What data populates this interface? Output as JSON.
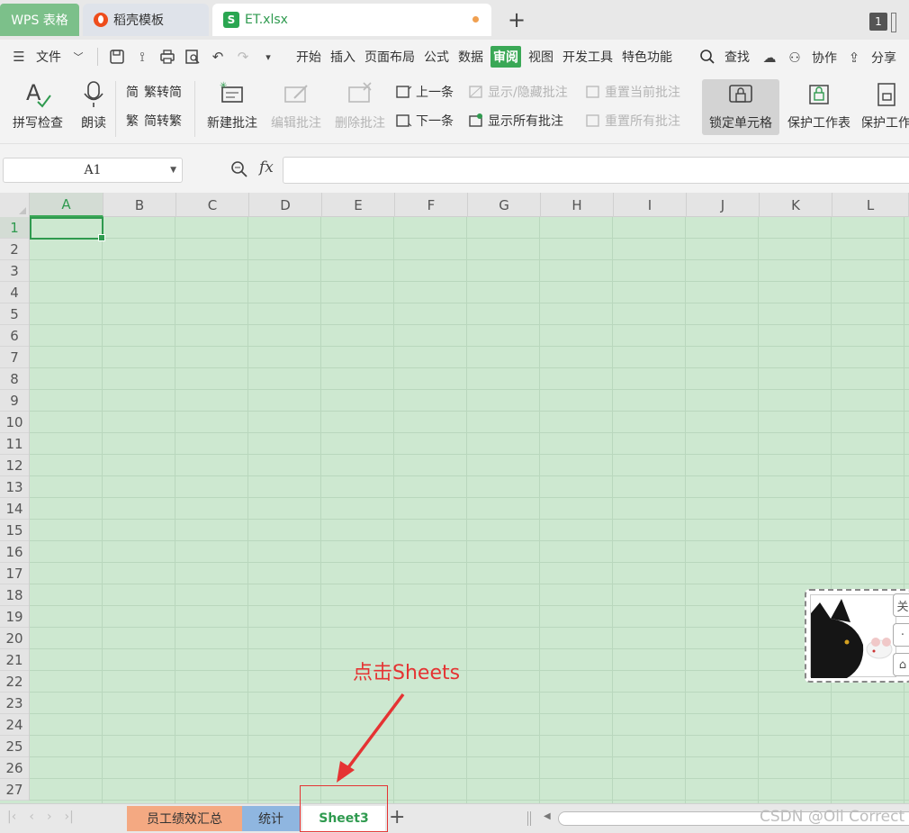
{
  "tabs": {
    "wps": "WPS 表格",
    "docer": "稻壳模板",
    "file": "ET.xlsx",
    "window_count": "1"
  },
  "menu": {
    "file": "文件",
    "items": [
      "开始",
      "插入",
      "页面布局",
      "公式",
      "数据",
      "审阅",
      "视图",
      "开发工具",
      "特色功能"
    ],
    "active": "审阅",
    "search": "查找",
    "collab": "协作",
    "share": "分享"
  },
  "ribbon": {
    "spell": "拼写检查",
    "read": "朗读",
    "trad_to_simp": "繁转简",
    "simp_to_trad": "简转繁",
    "new_comment": "新建批注",
    "edit_comment": "编辑批注",
    "delete_comment": "删除批注",
    "prev": "上一条",
    "next": "下一条",
    "show_hide": "显示/隐藏批注",
    "show_all": "显示所有批注",
    "reset_current": "重置当前批注",
    "reset_all": "重置所有批注",
    "lock_cell": "锁定单元格",
    "protect_sheet": "保护工作表",
    "protect_wb": "保护工作"
  },
  "formula": {
    "namebox": "A1",
    "fx": "fx",
    "value": ""
  },
  "grid": {
    "columns": [
      "A",
      "B",
      "C",
      "D",
      "E",
      "F",
      "G",
      "H",
      "I",
      "J",
      "K",
      "L"
    ],
    "rows": [
      "1",
      "2",
      "3",
      "4",
      "5",
      "6",
      "7",
      "8",
      "9",
      "10",
      "11",
      "12",
      "13",
      "14",
      "15",
      "16",
      "17",
      "18",
      "19",
      "20",
      "21",
      "22",
      "23",
      "24",
      "25",
      "26",
      "27"
    ],
    "selected_cell": "A1"
  },
  "pet": {
    "side1": "关"
  },
  "annotation": "点击Sheets",
  "sheets": {
    "tabs": [
      "员工绩效汇总",
      "统计",
      "Sheet3"
    ],
    "active": "Sheet3"
  },
  "watermark": "CSDN @Oll Correct",
  "colors": {
    "accent": "#2f9a4f",
    "grid_bg": "#cde8d0",
    "annotation": "#e53333"
  }
}
